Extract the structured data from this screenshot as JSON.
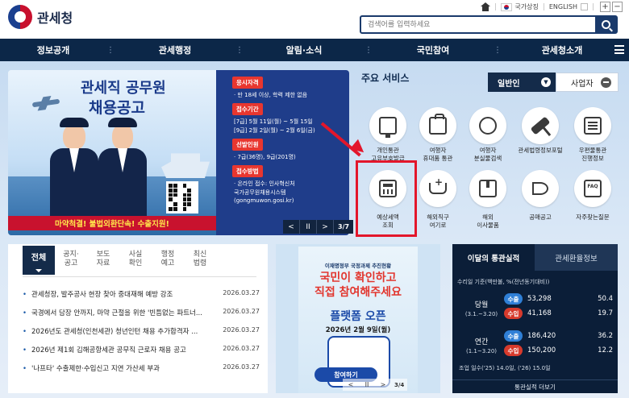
{
  "header": {
    "logo_text": "관세청",
    "util": {
      "national_symbol": "국가상징",
      "english": "ENGLISH",
      "zoom_in": "+",
      "zoom_out": "−"
    },
    "search_placeholder": "검색어를 입력하세요"
  },
  "nav": {
    "items": [
      "정보공개",
      "관세행정",
      "알림·소식",
      "국민참여",
      "관세청소개"
    ]
  },
  "banner": {
    "title_line1": "관세직 공무원",
    "title_line2": "채용공고",
    "strip": "마약척결! 불법외환단속! 수출지원!",
    "info": [
      {
        "tag": "응시자격",
        "lines": [
          "· 만 18세 이상, 학력 제한 없음"
        ]
      },
      {
        "tag": "접수기간",
        "lines": [
          "[7급] 5월 11일(월) ~ 5월 15일",
          "[9급] 2월 2일(월) ~ 2월 6일(금)"
        ]
      },
      {
        "tag": "선발인원",
        "lines": [
          "· 7급(36명), 9급(201명)"
        ]
      },
      {
        "tag": "접수방법",
        "lines": [
          "· 온라인 접수: 인사혁신처",
          "  국가공무원채용시스템",
          "  (gongmuwon.gosi.kr)"
        ]
      }
    ],
    "page": "3/7",
    "prev": "<",
    "pause": "II",
    "next": ">"
  },
  "services": {
    "title": "주요 서비스",
    "tab_general": "일반인",
    "tab_business": "사업자",
    "items": [
      {
        "label1": "개인통관",
        "label2": "고유부호발급"
      },
      {
        "label1": "여행자",
        "label2": "휴대품 통관"
      },
      {
        "label1": "여행자",
        "label2": "분실물검색"
      },
      {
        "label1": "관세법령정보포털",
        "label2": ""
      },
      {
        "label1": "우편물통관",
        "label2": "진행정보"
      },
      {
        "label1": "예상세액",
        "label2": "조회"
      },
      {
        "label1": "해외직구",
        "label2": "여기로"
      },
      {
        "label1": "해외",
        "label2": "이사물품"
      },
      {
        "label1": "공매공고",
        "label2": ""
      },
      {
        "label1": "자주찾는질문",
        "label2": ""
      }
    ]
  },
  "news": {
    "tabs": [
      {
        "l1": "전체",
        "l2": ""
      },
      {
        "l1": "공지·",
        "l2": "공고"
      },
      {
        "l1": "보도",
        "l2": "자료"
      },
      {
        "l1": "사실",
        "l2": "확인"
      },
      {
        "l1": "행정",
        "l2": "예고"
      },
      {
        "l1": "최신",
        "l2": "법령"
      }
    ],
    "items": [
      {
        "title": "관세청장, 발주공사 현장 찾아 중대재해 예방 강조",
        "date": "2026.03.27"
      },
      {
        "title": "국경에서 담장 안까지, 마약 근절을 위한 '빈틈없는 파트너...",
        "date": "2026.03.27"
      },
      {
        "title": "2026년도 관세청(인천세관) 청년인턴 채용 추가합격자 ...",
        "date": "2026.03.27"
      },
      {
        "title": "2026년 제1회 김해공항세관 공무직 근로자 채용 공고",
        "date": "2026.03.27"
      },
      {
        "title": "'나프타' 수출제한·수입신고 지연 가산세 부과",
        "date": "2026.03.27"
      }
    ]
  },
  "mid_banner": {
    "pre": "이재명정부 국정과제 추진현황",
    "h1_line1": "국민이 확인하고",
    "h1_line2": "직접 참여해주세요",
    "open": "플랫폼 오픈",
    "date": "2026년 2월 9일(월)",
    "cta": "참여하기",
    "page": "3/4",
    "prev": "<",
    "pause": "II",
    "next": ">"
  },
  "stats": {
    "tab_active": "이달의 통관실적",
    "tab_other": "관세환율정보",
    "basis": "수리일 기준(백만불, %(전년동기대비))",
    "month": {
      "label": "당월",
      "range": "(3.1.~3.20)",
      "export_label": "수출",
      "export_amt": "53,298",
      "export_pct": "50.4",
      "import_label": "수입",
      "import_amt": "41,168",
      "import_pct": "19.7"
    },
    "year": {
      "label": "연간",
      "range": "(1.1~3.20)",
      "export_label": "수출",
      "export_amt": "186,420",
      "export_pct": "36.2",
      "import_label": "수입",
      "import_amt": "150,200",
      "import_pct": "12.2"
    },
    "days": "조업 일수('25) 14.0일, ('26) 15.0일",
    "more": "통관실적 더보기"
  },
  "colors": {
    "navy": "#0c2748",
    "accent_red": "#e3162b",
    "export_blue": "#2f7fd6",
    "import_red": "#d73a2c"
  }
}
